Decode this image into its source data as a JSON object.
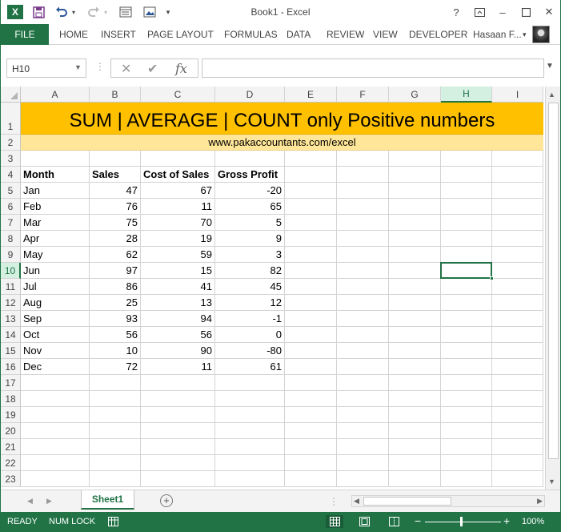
{
  "window": {
    "title": "Book1 - Excel",
    "help": "?",
    "minimize": "–",
    "close": "✕"
  },
  "ribbon": {
    "file": "FILE",
    "tabs": [
      "HOME",
      "INSERT",
      "PAGE LAYOUT",
      "FORMULAS",
      "DATA",
      "REVIEW",
      "VIEW",
      "DEVELOPER"
    ],
    "user": "Hasaan F...",
    "user_dropdown": "▾"
  },
  "formula_bar": {
    "name_box": "H10",
    "fx": "fx",
    "cancel": "✕",
    "enter": "✔",
    "formula": ""
  },
  "grid": {
    "columns": [
      "A",
      "B",
      "C",
      "D",
      "E",
      "F",
      "G",
      "H",
      "I"
    ],
    "active_column": "H",
    "active_row": "10",
    "rows": [
      "1",
      "2",
      "3",
      "4",
      "5",
      "6",
      "7",
      "8",
      "9",
      "10",
      "11",
      "12",
      "13",
      "14",
      "15",
      "16",
      "17",
      "18",
      "19",
      "20",
      "21",
      "22",
      "23"
    ],
    "title": "SUM | AVERAGE | COUNT only Positive numbers",
    "url": "www.pakaccountants.com/excel",
    "headers": [
      "Month",
      "Sales",
      "Cost of Sales",
      "Gross Profit"
    ],
    "data": [
      [
        "Jan",
        "47",
        "67",
        "-20"
      ],
      [
        "Feb",
        "76",
        "11",
        "65"
      ],
      [
        "Mar",
        "75",
        "70",
        "5"
      ],
      [
        "Apr",
        "28",
        "19",
        "9"
      ],
      [
        "May",
        "62",
        "59",
        "3"
      ],
      [
        "Jun",
        "97",
        "15",
        "82"
      ],
      [
        "Jul",
        "86",
        "41",
        "45"
      ],
      [
        "Aug",
        "25",
        "13",
        "12"
      ],
      [
        "Sep",
        "93",
        "94",
        "-1"
      ],
      [
        "Oct",
        "56",
        "56",
        "0"
      ],
      [
        "Nov",
        "10",
        "90",
        "-80"
      ],
      [
        "Dec",
        "72",
        "11",
        "61"
      ]
    ],
    "colors": {
      "title_fill": "#ffc000",
      "url_fill": "#ffe699",
      "accent": "#217346"
    }
  },
  "sheets": {
    "tabs": [
      "Sheet1"
    ],
    "add": "+",
    "nav_prev": "◀",
    "nav_next": "▶"
  },
  "status": {
    "mode": "READY",
    "num_lock": "NUM LOCK",
    "zoom": "100%",
    "zoom_minus": "−",
    "zoom_plus": "+"
  },
  "icons": {
    "logo": "X",
    "save": "save-icon",
    "undo": "undo-icon",
    "redo": "redo-icon"
  }
}
